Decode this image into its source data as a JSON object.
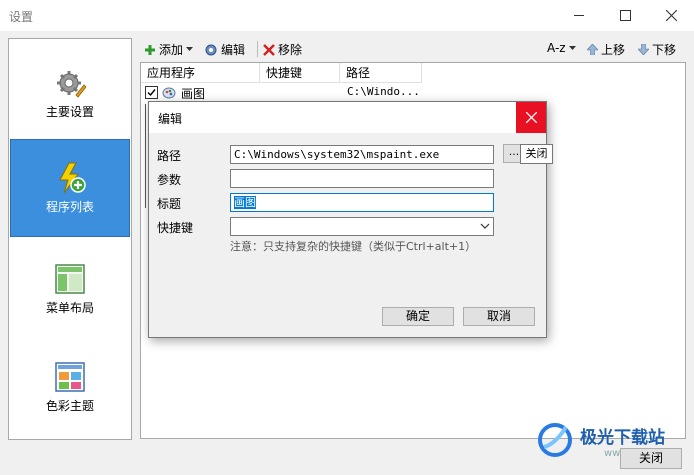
{
  "window": {
    "title": "设置"
  },
  "sidebar": {
    "items": [
      {
        "label": "主要设置",
        "icon": "gear-wrench-icon",
        "active": false
      },
      {
        "label": "程序列表",
        "icon": "lightning-add-icon",
        "active": true
      },
      {
        "label": "菜单布局",
        "icon": "layout-icon",
        "active": false
      },
      {
        "label": "色彩主题",
        "icon": "color-palette-icon",
        "active": false
      }
    ]
  },
  "toolbar": {
    "add": "添加",
    "edit": "编辑",
    "remove": "移除",
    "sort": "A-z",
    "move_up": "上移",
    "move_down": "下移"
  },
  "list": {
    "columns": [
      "应用程序",
      "快捷键",
      "路径"
    ],
    "rows": [
      {
        "checked": true,
        "name": "画图",
        "shortcut": "",
        "path": "C:\\Windo..."
      }
    ]
  },
  "dialog": {
    "title": "编辑",
    "fields": {
      "path": {
        "label": "路径",
        "value": "C:\\Windows\\system32\\mspaint.exe"
      },
      "args": {
        "label": "参数",
        "value": ""
      },
      "caption": {
        "label": "标题",
        "value": "画图"
      },
      "hotkey": {
        "label": "快捷键",
        "value": ""
      }
    },
    "browse_label": "...",
    "tooltip": "关闭",
    "note": "注意：只支持复杂的快捷键（类似于Ctrl+alt+1）",
    "ok": "确定",
    "cancel": "取消"
  },
  "footer": {
    "close": "关闭"
  },
  "watermark": {
    "brand": "极光下载站",
    "url": "www.xz7.com"
  },
  "colors": {
    "accent": "#3b8fdc",
    "close_red": "#e81123",
    "focus": "#0078d7"
  }
}
